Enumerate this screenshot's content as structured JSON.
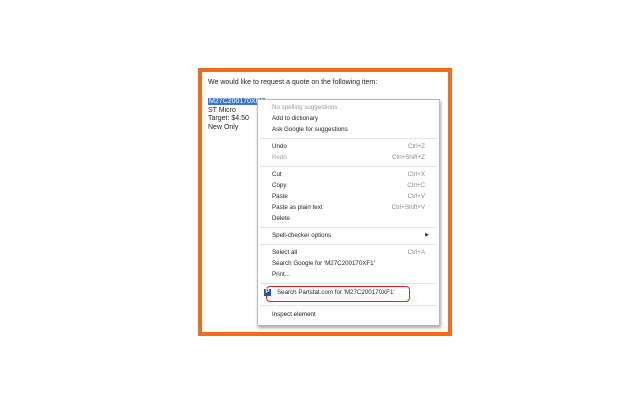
{
  "email": {
    "intro": "We would like to request a quote on the following item:",
    "part_number": "M27C200170XF1",
    "manufacturer": "ST Micro",
    "target": "Target: $4.50",
    "condition": "New Only"
  },
  "context_menu": {
    "spell": {
      "no_suggestions": "No spelling suggestions",
      "add_dictionary": "Add to dictionary",
      "ask_google": "Ask Google for suggestions"
    },
    "edit": {
      "undo": "Undo",
      "undo_sc": "Ctrl+Z",
      "redo": "Redo",
      "redo_sc": "Ctrl+Shift+Z"
    },
    "clipboard": {
      "cut": "Cut",
      "cut_sc": "Ctrl+X",
      "copy": "Copy",
      "copy_sc": "Ctrl+C",
      "paste": "Paste",
      "paste_sc": "Ctrl+V",
      "paste_plain": "Paste as plain text",
      "paste_plain_sc": "Ctrl+Shift+V",
      "delete": "Delete"
    },
    "spell_options": "Spell-checker options",
    "selection": {
      "select_all": "Select all",
      "select_all_sc": "Ctrl+A",
      "search_google": "Search Google for 'M27C200170XF1'",
      "print": "Print..."
    },
    "partstat": {
      "icon_letter": "P",
      "label": "Search Partstat.com for 'M27C200170XF1'"
    },
    "inspect": "Inspect element"
  },
  "colors": {
    "frame_border": "#f26b1d",
    "selection": "#3a75d4",
    "highlight": "#e2231a",
    "partstat_brand": "#1e56a0"
  }
}
